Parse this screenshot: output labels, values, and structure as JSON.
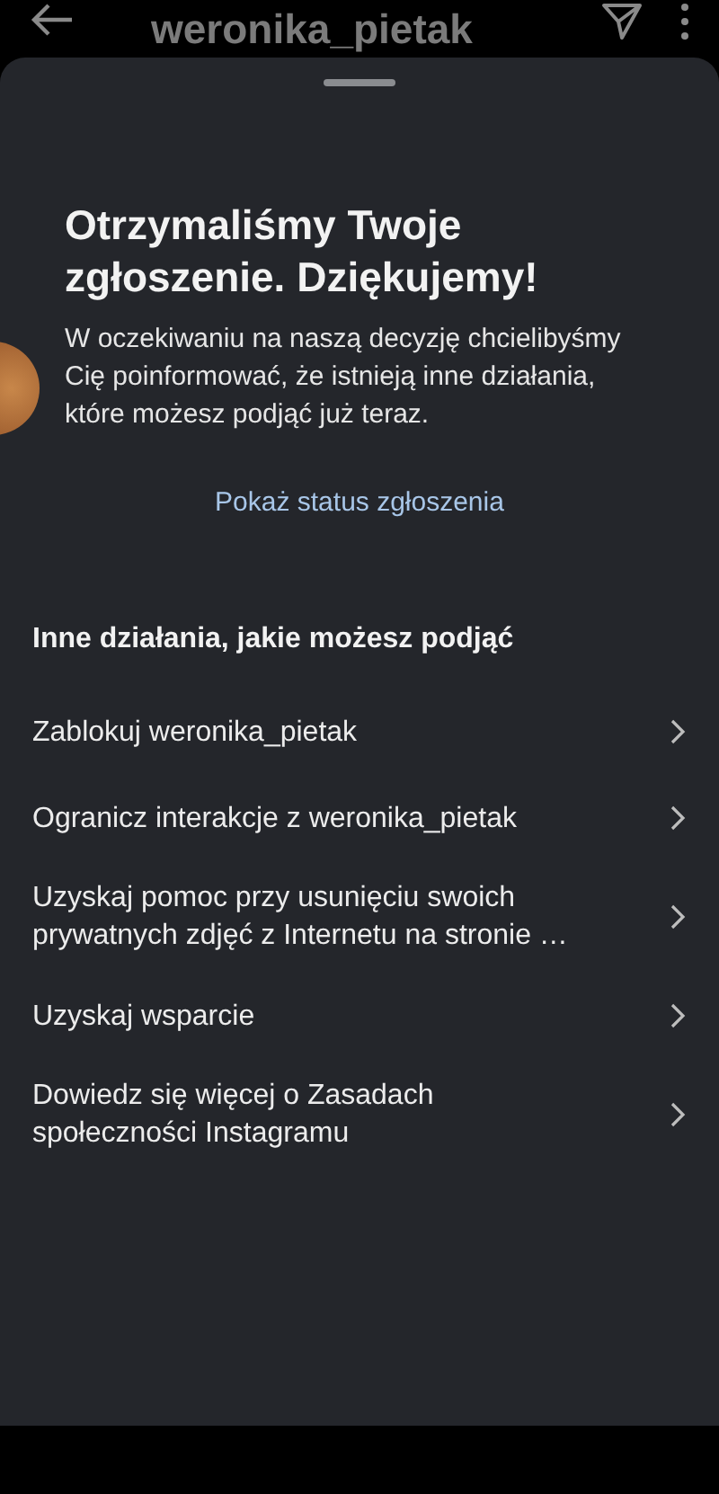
{
  "header": {
    "title": "weronika_pietak"
  },
  "sheet": {
    "heading": "Otrzymaliśmy Twoje zgłoszenie. Dziękujemy!",
    "message": "W oczekiwaniu na naszą decyzję chcielibyśmy Cię poinformować, że istnieją inne działania, które możesz podjąć już teraz.",
    "status_link": "Pokaż status zgłoszenia",
    "section_title": "Inne działania, jakie możesz podjąć",
    "actions": [
      {
        "label": "Zablokuj weronika_pietak"
      },
      {
        "label": "Ogranicz interakcje z weronika_pietak"
      },
      {
        "label": "Uzyskaj pomoc przy usunięciu swoich prywatnych zdjęć z Internetu na stronie …"
      },
      {
        "label": "Uzyskaj wsparcie"
      },
      {
        "label": "Dowiedz się więcej o Zasadach społeczności Instagramu"
      }
    ]
  }
}
